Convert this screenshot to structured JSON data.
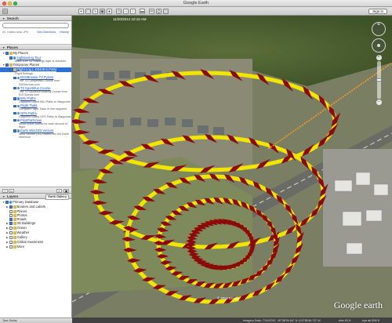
{
  "window": {
    "title": "Google Earth",
    "sign_in": "Sign in"
  },
  "search": {
    "header": "Search",
    "placeholder": "",
    "hint": "ex: Hotels near JFK",
    "get_directions": "Get Directions",
    "history": "History"
  },
  "places": {
    "header": "Places",
    "items": [
      {
        "label": "My Places",
        "level": 0,
        "icon": "folder-icon",
        "arrow": "▼",
        "checked": true,
        "link": false
      },
      {
        "label": "Sightseeing Tour",
        "level": 1,
        "icon": "globe-icon",
        "arrow": "",
        "checked": true,
        "link": true,
        "sub": "Make sure 3D Buildings layer is checked"
      },
      {
        "label": "Temporary Places",
        "level": 0,
        "icon": "folder-icon",
        "arrow": "▼",
        "checked": true,
        "link": false
      },
      {
        "label": "Flight Log L-D0409-6.FWM",
        "level": 1,
        "icon": "folder-icon",
        "arrow": "▼",
        "checked": true,
        "link": true,
        "selected": true,
        "sub": "Flight Settings"
      },
      {
        "label": "DSSBrowse T3 Pylons",
        "level": 2,
        "icon": "globe-icon",
        "arrow": "",
        "checked": true,
        "link": true,
        "sub": "The T3 Competition Course from DHSchrivas.com"
      },
      {
        "label": "T3 Sportsfun Course",
        "level": 2,
        "icon": "globe-icon",
        "arrow": "",
        "checked": true,
        "link": true,
        "sub": "The T3 Sportsfun building Course from EOCDonas.com"
      },
      {
        "label": "IMU Paths",
        "level": 2,
        "icon": "globe-icon",
        "arrow": "",
        "checked": true,
        "link": true,
        "sub": "Coloured Coded IMU Paths to Waypoints"
      },
      {
        "label": "Flight Trails",
        "level": 2,
        "icon": "globe-icon",
        "arrow": "",
        "checked": true,
        "link": true,
        "sub": "Complete Flight Trace in one segment"
      },
      {
        "label": "GPS Paths",
        "level": 2,
        "icon": "globe-icon",
        "arrow": "",
        "checked": true,
        "link": true,
        "sub": "Coloured Coded GPS Paths to Waypoints"
      },
      {
        "label": "Pilot/PathView",
        "level": 2,
        "icon": "globe-icon",
        "arrow": "",
        "checked": true,
        "link": true,
        "sub": "Model plane plotted for each second of flight"
      },
      {
        "label": "Earth Wind:D3 Vectors",
        "level": 2,
        "icon": "globe-icon",
        "arrow": "",
        "checked": true,
        "link": true,
        "sub": "Wind Vectors (3D) rotated into the Earth reference"
      }
    ]
  },
  "layers": {
    "header": "Layers",
    "earth_gallery": "Earth Gallery",
    "items": [
      {
        "label": "Primary Database",
        "level": 0,
        "icon": "globe-icon",
        "arrow": "▼",
        "checked": true
      },
      {
        "label": "Borders and Labels",
        "level": 1,
        "icon": "folder-icon",
        "arrow": "▶",
        "checked": true
      },
      {
        "label": "Places",
        "level": 1,
        "icon": "folder-icon",
        "arrow": "",
        "checked": false
      },
      {
        "label": "Photos",
        "level": 1,
        "icon": "folder-icon",
        "arrow": "",
        "checked": false
      },
      {
        "label": "Roads",
        "level": 1,
        "icon": "folder-icon",
        "arrow": "",
        "checked": true
      },
      {
        "label": "3D Buildings",
        "level": 1,
        "icon": "folder-icon",
        "arrow": "▶",
        "checked": true
      },
      {
        "label": "Ocean",
        "level": 1,
        "icon": "folder-icon",
        "arrow": "▶",
        "checked": false
      },
      {
        "label": "Weather",
        "level": 1,
        "icon": "folder-icon",
        "arrow": "▶",
        "checked": false
      },
      {
        "label": "Gallery",
        "level": 1,
        "icon": "folder-icon",
        "arrow": "▶",
        "checked": false
      },
      {
        "label": "Global Awareness",
        "level": 1,
        "icon": "folder-icon",
        "arrow": "▶",
        "checked": false
      },
      {
        "label": "More",
        "level": 1,
        "icon": "folder-icon",
        "arrow": "▶",
        "checked": false
      }
    ]
  },
  "tour_guide": "Tour Guide",
  "map": {
    "date_overlay": "11/20/2014 10:16 AM",
    "copyright": "© 2014 Google",
    "logo": "Google earth",
    "imagery_date": "Imagery Date: 7/31/2012",
    "coords": "40°58'54.64\" N 124°38'46.79\" W",
    "elev": "elev 81 ft",
    "eye_alt": "eye alt 598 ft",
    "compass_north": "N",
    "colors": {
      "ring": "#f2e600",
      "vectors": "#8b0a0a",
      "trail": "#ff9a1f"
    }
  }
}
